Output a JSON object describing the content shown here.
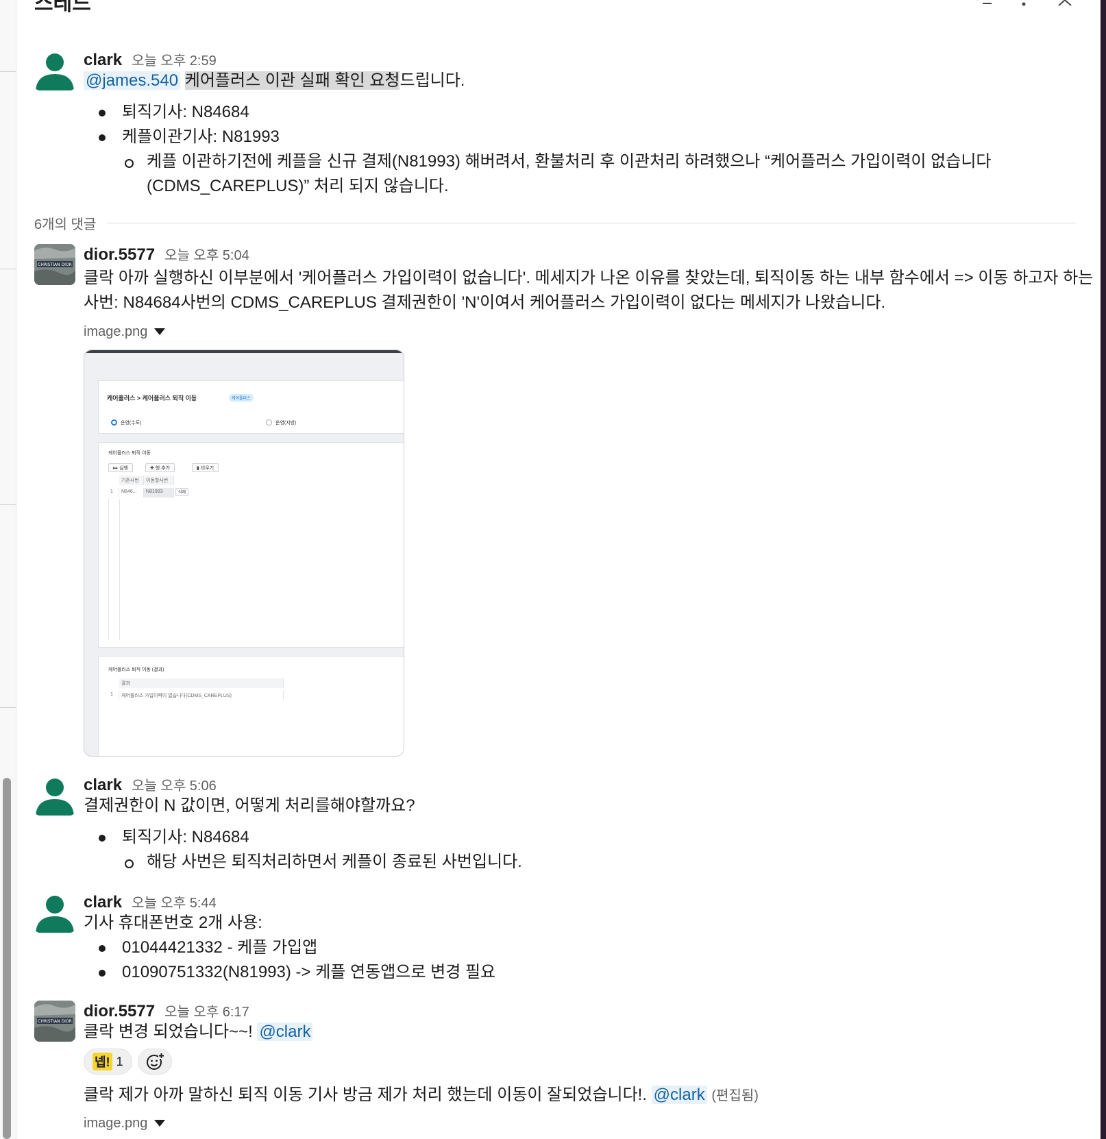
{
  "header": {
    "title": "스레드"
  },
  "icons": {
    "thread_list": "list-check-icon",
    "more": "kebab-more-icon",
    "close": "close-icon"
  },
  "parent": {
    "author": "clark",
    "time": "오늘 오후 2:59",
    "mention": "@james.540",
    "highlight": "케어플러스 이관 실패 확인 요청",
    "suffix": "드립니다.",
    "bullets": [
      {
        "text": "퇴직기사: N84684"
      },
      {
        "text": "케플이관기사: N81993"
      }
    ],
    "sub_bullet": "케플 이관하기전에 케플을 신규 결제(N81993) 해버려서, 환불처리 후 이관처리 하려했으나 “케어플러스 가입이력이 없습니다(CDMS_CAREPLUS)” 처리 되지 않습니다."
  },
  "reply_divider": {
    "label": "6개의 댓글"
  },
  "replies": [
    {
      "author": "dior.5577",
      "time": "오늘 오후 5:04",
      "text": "클락 아까 실행하신 이부분에서  '케어플러스 가입이력이 없습니다'. 메세지가 나온 이유를 찾았는데, 퇴직이동 하는 내부 함수에서 => 이동 하고자 하는 사번: N84684사번의  CDMS_CAREPLUS 결제권한이 'N'이여서 케어플러스 가입이력이 없다는 메세지가 나왔습니다.",
      "file": "image.png"
    },
    {
      "author": "clark",
      "time": "오늘 오후 5:06",
      "text": "결제권한이 N 값이면, 어떻게 처리를해야할까요?",
      "bullet": "퇴직기사: N84684",
      "sub_bullet": "해당 사번은 퇴직처리하면서 케플이 종료된 사번입니다."
    },
    {
      "author": "clark",
      "time": "오늘 오후 5:44",
      "text": "기사 휴대폰번호 2개 사용:",
      "bullets": [
        {
          "text": "01044421332 - 케플 가입앱"
        },
        {
          "text": "01090751332(N81993) -> 케플 연동앱으로 변경 필요"
        }
      ]
    },
    {
      "author": "dior.5577",
      "time": "오늘 오후 6:17",
      "text": "클락 변경 되었습니다~~!",
      "mention": "@clark",
      "reaction": {
        "emoji": "넵!",
        "count": "1"
      },
      "text2": "클락 제가 아까 말하신 퇴직 이동 기사 방금 제가 처리 했는데 이동이 잘되었습니다!.",
      "mention2": "@clark",
      "edited": "(편집됨)",
      "file": "image.png"
    }
  ],
  "screenshot": {
    "breadcrumb": "케어플러스 > 케어플러스 퇴직 이동",
    "badge": "케어플러스",
    "radio_on": "운영(수도)",
    "radio_off": "운영(지방)",
    "grid_title": "케어플러스 퇴직 이동",
    "btn_run": "▸▸ 실행",
    "btn_add": "✚ 행 추가",
    "btn_clear": "▮ 비우기",
    "col1": "기존사번",
    "col2": "이동할사번",
    "row_no": "1",
    "row_c1": "N846...",
    "row_c2": "N81993",
    "row_del": "삭제",
    "result_title": "케어플러스 퇴직 이동 (결과)",
    "result_col": "결과",
    "result_no": "1",
    "result_val": "케어플러스 가입이력이 없습니다(CDMS_CAREPLUS)"
  }
}
